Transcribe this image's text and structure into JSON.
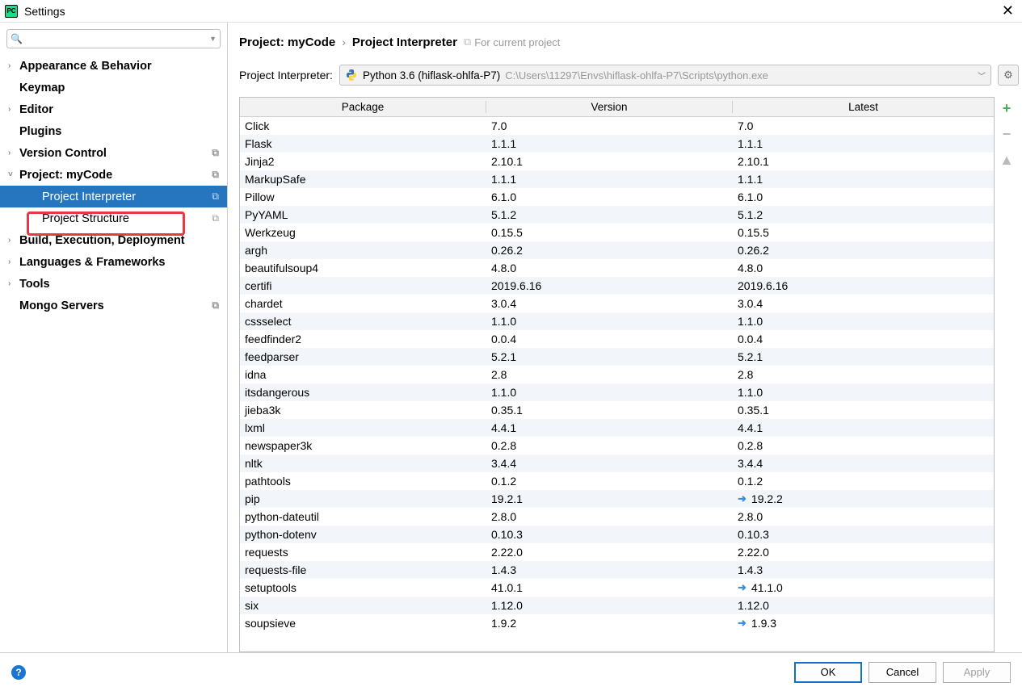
{
  "window": {
    "title": "Settings"
  },
  "sidebar": {
    "search_placeholder": "",
    "items": [
      {
        "label": "Appearance & Behavior",
        "arrow": true,
        "bold": true
      },
      {
        "label": "Keymap",
        "arrow": false,
        "bold": true
      },
      {
        "label": "Editor",
        "arrow": true,
        "bold": true
      },
      {
        "label": "Plugins",
        "arrow": false,
        "bold": true
      },
      {
        "label": "Version Control",
        "arrow": true,
        "bold": true,
        "copy": true
      },
      {
        "label": "Project: myCode",
        "arrow": true,
        "bold": true,
        "expanded": true,
        "copy": true
      },
      {
        "label": "Project Interpreter",
        "child": true,
        "selected": true,
        "copy": true
      },
      {
        "label": "Project Structure",
        "child": true,
        "copy": true
      },
      {
        "label": "Build, Execution, Deployment",
        "arrow": true,
        "bold": true
      },
      {
        "label": "Languages & Frameworks",
        "arrow": true,
        "bold": true
      },
      {
        "label": "Tools",
        "arrow": true,
        "bold": true
      },
      {
        "label": "Mongo Servers",
        "arrow": false,
        "bold": true,
        "copy": true
      }
    ]
  },
  "breadcrumb": {
    "a": "Project: myCode",
    "b": "Project Interpreter",
    "note": "For current project"
  },
  "interpreter": {
    "label": "Project Interpreter:",
    "selected": "Python 3.6 (hiflask-ohlfa-P7)",
    "path": "C:\\Users\\11297\\Envs\\hiflask-ohlfa-P7\\Scripts\\python.exe"
  },
  "columns": {
    "pkg": "Package",
    "ver": "Version",
    "lat": "Latest"
  },
  "packages": [
    {
      "name": "Click",
      "version": "7.0",
      "latest": "7.0"
    },
    {
      "name": "Flask",
      "version": "1.1.1",
      "latest": "1.1.1"
    },
    {
      "name": "Jinja2",
      "version": "2.10.1",
      "latest": "2.10.1"
    },
    {
      "name": "MarkupSafe",
      "version": "1.1.1",
      "latest": "1.1.1"
    },
    {
      "name": "Pillow",
      "version": "6.1.0",
      "latest": "6.1.0"
    },
    {
      "name": "PyYAML",
      "version": "5.1.2",
      "latest": "5.1.2"
    },
    {
      "name": "Werkzeug",
      "version": "0.15.5",
      "latest": "0.15.5"
    },
    {
      "name": "argh",
      "version": "0.26.2",
      "latest": "0.26.2"
    },
    {
      "name": "beautifulsoup4",
      "version": "4.8.0",
      "latest": "4.8.0"
    },
    {
      "name": "certifi",
      "version": "2019.6.16",
      "latest": "2019.6.16"
    },
    {
      "name": "chardet",
      "version": "3.0.4",
      "latest": "3.0.4"
    },
    {
      "name": "cssselect",
      "version": "1.1.0",
      "latest": "1.1.0"
    },
    {
      "name": "feedfinder2",
      "version": "0.0.4",
      "latest": "0.0.4"
    },
    {
      "name": "feedparser",
      "version": "5.2.1",
      "latest": "5.2.1"
    },
    {
      "name": "idna",
      "version": "2.8",
      "latest": "2.8"
    },
    {
      "name": "itsdangerous",
      "version": "1.1.0",
      "latest": "1.1.0"
    },
    {
      "name": "jieba3k",
      "version": "0.35.1",
      "latest": "0.35.1"
    },
    {
      "name": "lxml",
      "version": "4.4.1",
      "latest": "4.4.1"
    },
    {
      "name": "newspaper3k",
      "version": "0.2.8",
      "latest": "0.2.8"
    },
    {
      "name": "nltk",
      "version": "3.4.4",
      "latest": "3.4.4"
    },
    {
      "name": "pathtools",
      "version": "0.1.2",
      "latest": "0.1.2"
    },
    {
      "name": "pip",
      "version": "19.2.1",
      "latest": "19.2.2",
      "update": true
    },
    {
      "name": "python-dateutil",
      "version": "2.8.0",
      "latest": "2.8.0"
    },
    {
      "name": "python-dotenv",
      "version": "0.10.3",
      "latest": "0.10.3"
    },
    {
      "name": "requests",
      "version": "2.22.0",
      "latest": "2.22.0"
    },
    {
      "name": "requests-file",
      "version": "1.4.3",
      "latest": "1.4.3"
    },
    {
      "name": "setuptools",
      "version": "41.0.1",
      "latest": "41.1.0",
      "update": true
    },
    {
      "name": "six",
      "version": "1.12.0",
      "latest": "1.12.0"
    },
    {
      "name": "soupsieve",
      "version": "1.9.2",
      "latest": "1.9.3",
      "update": true
    }
  ],
  "footer": {
    "ok": "OK",
    "cancel": "Cancel",
    "apply": "Apply"
  }
}
